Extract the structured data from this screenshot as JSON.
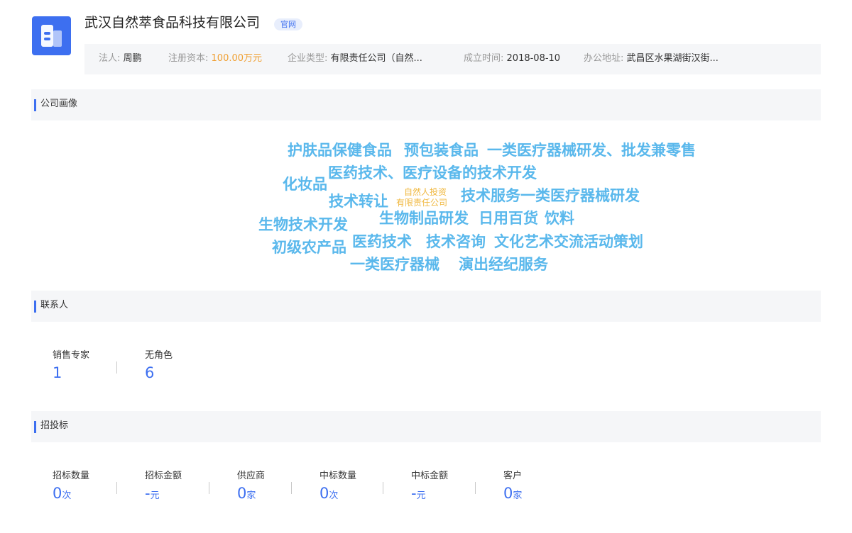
{
  "company": {
    "name": "武汉自然萃食品科技有限公司",
    "official_site_tag": "官网",
    "logo_icon": "building-icon",
    "accent_color": "#3d6ff0"
  },
  "info": {
    "legal_person": {
      "label": "法人:",
      "value": "周鹏"
    },
    "registered_capital": {
      "label": "注册资本:",
      "value": "100.00万元"
    },
    "company_type": {
      "label": "企业类型:",
      "value": "有限责任公司（自然..."
    },
    "founded": {
      "label": "成立时间:",
      "value": "2018-08-10"
    },
    "address": {
      "label": "办公地址:",
      "value": "武昌区水果湖街汉街..."
    }
  },
  "sections": {
    "portrait": "公司画像",
    "contacts": "联系人",
    "bidding": "招投标"
  },
  "word_cloud": [
    "护肤品保健食品",
    "预包装食品",
    "一类医疗器械研发、批发兼零售",
    "医药技术、医疗设备的技术开发",
    "化妆品",
    "技术转让",
    "自然人投资",
    "有限责任公司",
    "技术服务一类医疗器械研发",
    "生物技术开发",
    "生物制品研发",
    "日用百货",
    "饮料",
    "初级农产品",
    "医药技术",
    "技术咨询",
    "文化艺术交流活动策划",
    "一类医疗器械",
    "演出经纪服务"
  ],
  "contacts": [
    {
      "label": "销售专家",
      "value": "1"
    },
    {
      "label": "无角色",
      "value": "6"
    }
  ],
  "bidding": [
    {
      "label": "招标数量",
      "value": "0",
      "unit": "次"
    },
    {
      "label": "招标金额",
      "value": "-",
      "unit": "元"
    },
    {
      "label": "供应商",
      "value": "0",
      "unit": "家"
    },
    {
      "label": "中标数量",
      "value": "0",
      "unit": "次"
    },
    {
      "label": "中标金额",
      "value": "-",
      "unit": "元"
    },
    {
      "label": "客户",
      "value": "0",
      "unit": "家"
    }
  ]
}
